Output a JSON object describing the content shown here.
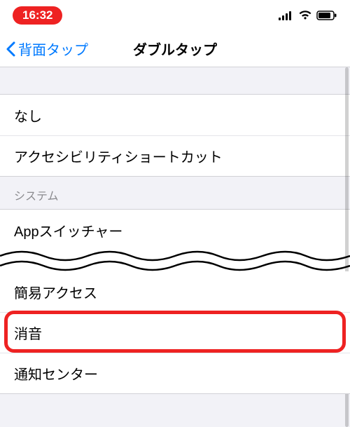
{
  "status": {
    "time": "16:32"
  },
  "nav": {
    "back_label": "背面タップ",
    "title": "ダブルタップ"
  },
  "group1": {
    "items": [
      {
        "label": "なし"
      },
      {
        "label": "アクセシビリティショートカット"
      }
    ]
  },
  "section_system_header": "システム",
  "group2_top": {
    "items": [
      {
        "label": "Appスイッチャー"
      }
    ]
  },
  "group2_bottom": {
    "items": [
      {
        "label": "簡易アクセス"
      },
      {
        "label": "消音"
      },
      {
        "label": "通知センター"
      }
    ]
  },
  "highlight_index": 1
}
